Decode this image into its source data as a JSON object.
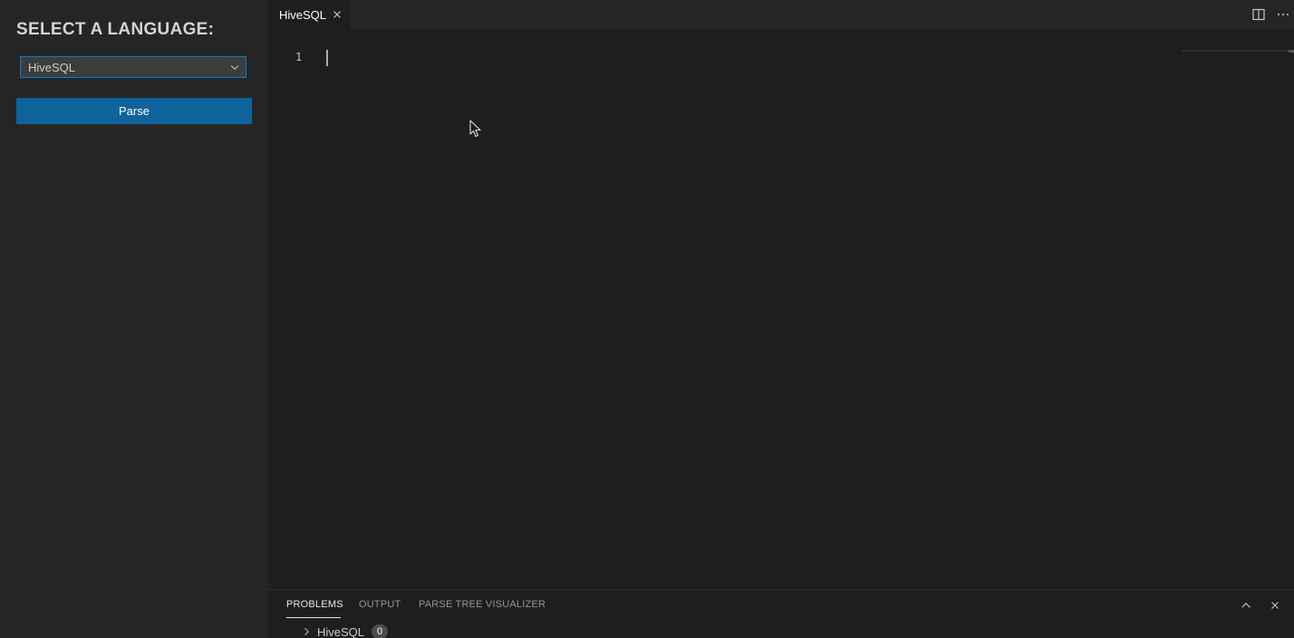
{
  "sidebar": {
    "title": "SELECT A LANGUAGE:",
    "language_select": {
      "value": "HiveSQL"
    },
    "parse_button": "Parse"
  },
  "editor_tabs": [
    {
      "label": "HiveSQL",
      "active": true
    }
  ],
  "editor": {
    "line_numbers": [
      "1"
    ]
  },
  "panel": {
    "tabs": [
      {
        "label": "PROBLEMS",
        "active": true
      },
      {
        "label": "OUTPUT",
        "active": false
      },
      {
        "label": "PARSE TREE VISUALIZER",
        "active": false
      }
    ],
    "problems": [
      {
        "label": "HiveSQL",
        "count": "0"
      }
    ]
  },
  "colors": {
    "accent": "#0e639c",
    "focus_border": "#007fd4",
    "sidebar_bg": "#252526",
    "editor_bg": "#1e1e1e"
  },
  "icons": [
    "chevron-down-icon",
    "close-icon",
    "split-editor-icon",
    "more-actions-icon",
    "chevron-up-icon",
    "chevron-right-icon",
    "mouse-pointer-icon"
  ]
}
